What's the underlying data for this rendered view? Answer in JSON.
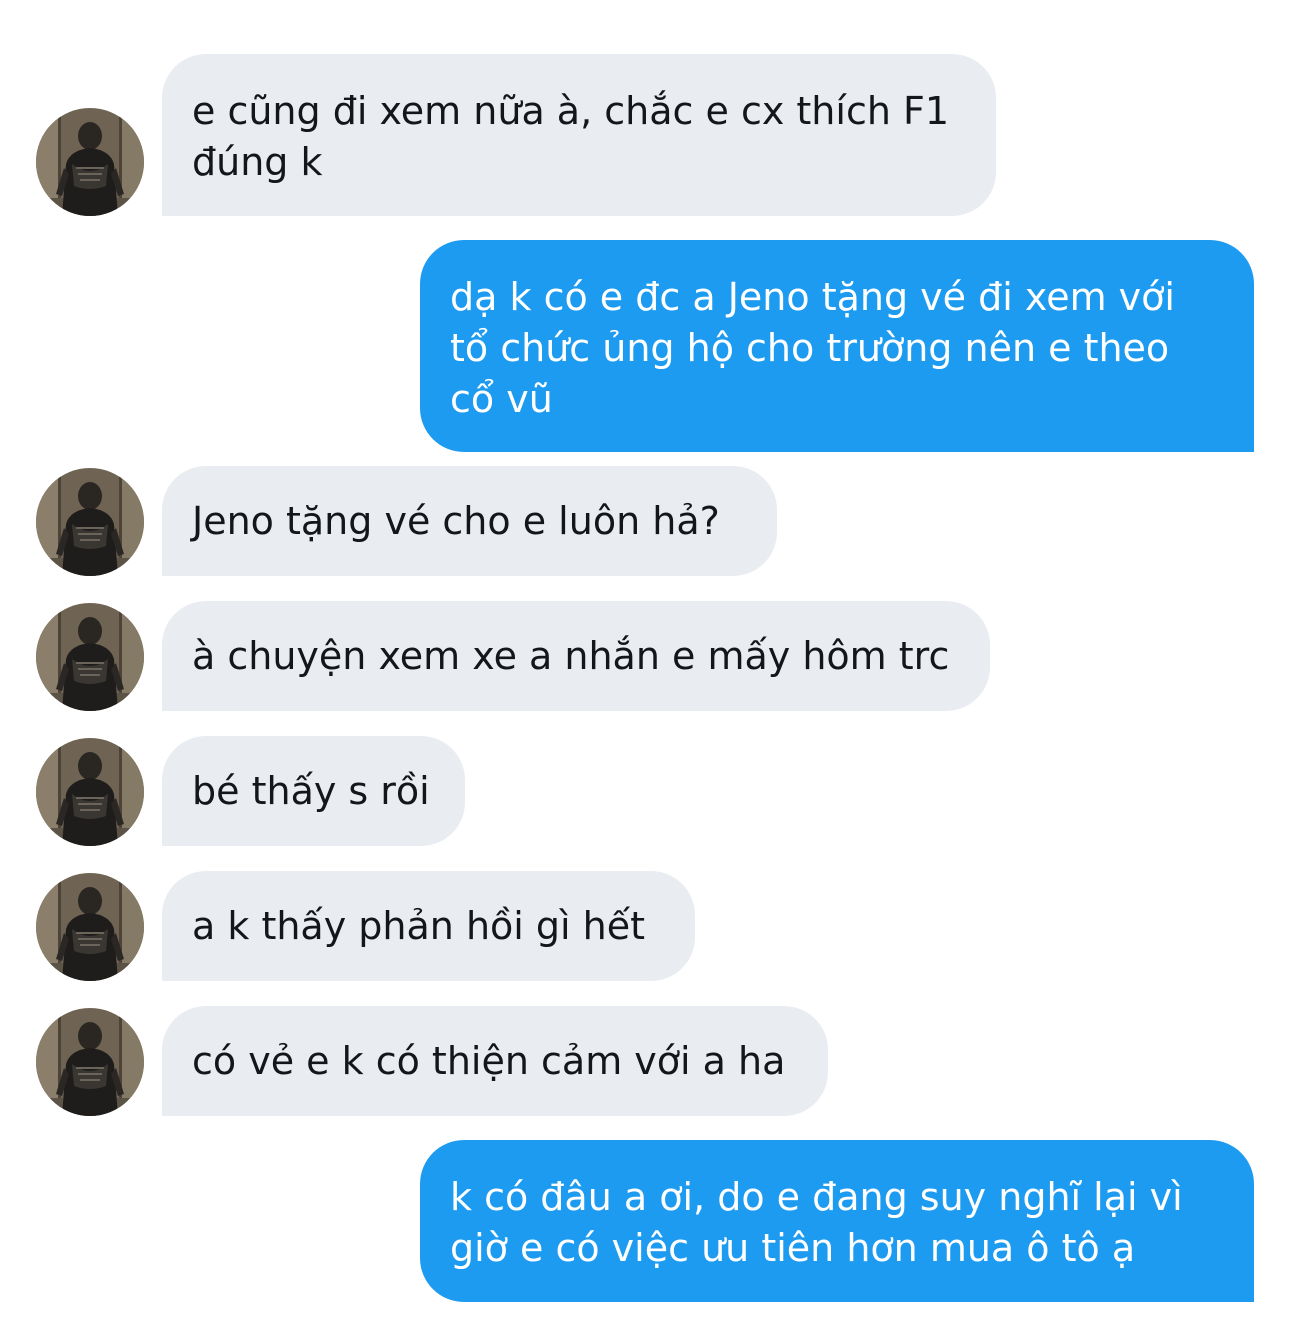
{
  "conversation": {
    "messages": [
      {
        "sender": "other",
        "text": "e cũng đi xem nữa à, chắc e cx thích F1\nđúng k"
      },
      {
        "sender": "me",
        "text": "dạ k có e đc a Jeno tặng vé đi xem với\ntổ chức ủng hộ cho trường nên e theo\ncổ vũ"
      },
      {
        "sender": "other",
        "text": "Jeno tặng vé cho e luôn hả?"
      },
      {
        "sender": "other",
        "text": "à chuyện xem xe a nhắn e mấy hôm trc"
      },
      {
        "sender": "other",
        "text": "bé thấy s rồi"
      },
      {
        "sender": "other",
        "text": "a k thấy phản hồi gì hết"
      },
      {
        "sender": "other",
        "text": "có vẻ e k có thiện cảm với a ha"
      },
      {
        "sender": "me",
        "text": "k có đâu a ơi, do e đang suy nghĩ lại vì\ngiờ e có việc ưu tiên hơn mua ô tô ạ"
      }
    ]
  },
  "colors": {
    "incoming_bubble": "#e9ecf0",
    "outgoing_bubble": "#1d9bf0",
    "incoming_text": "#14171a",
    "outgoing_text": "#ffffff",
    "background": "#ffffff"
  },
  "icons": {
    "contact_avatar": "avatar-photo-icon"
  }
}
